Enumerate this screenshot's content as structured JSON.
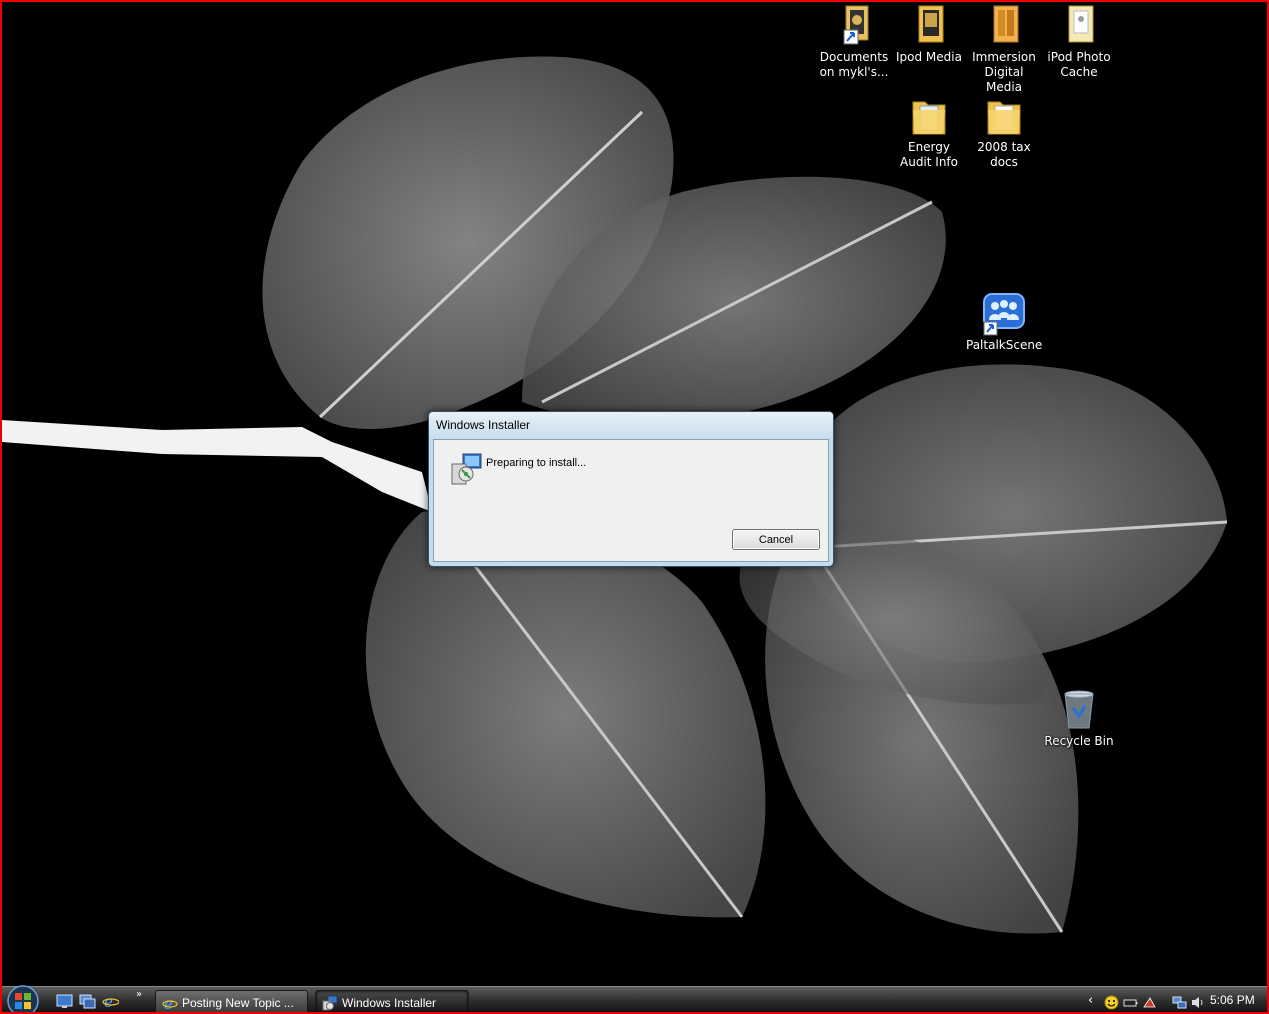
{
  "desktop_icons": [
    {
      "id": "documents",
      "label": "Documents on mykl's..."
    },
    {
      "id": "ipod-media",
      "label": "Ipod Media"
    },
    {
      "id": "immersion",
      "label": "Immersion Digital Media"
    },
    {
      "id": "ipod-photo",
      "label": "iPod Photo Cache"
    },
    {
      "id": "energy",
      "label": "Energy Audit Info"
    },
    {
      "id": "tax",
      "label": "2008 tax docs"
    },
    {
      "id": "paltalk",
      "label": "PaltalkScene"
    },
    {
      "id": "recycle",
      "label": "Recycle Bin"
    }
  ],
  "dialog": {
    "title": "Windows Installer",
    "message": "Preparing to install...",
    "cancel_label": "Cancel"
  },
  "taskbar": {
    "more_symbol": "»",
    "tasks": [
      {
        "label": "Posting New Topic ..."
      },
      {
        "label": "Windows Installer"
      }
    ],
    "tray_chevron": "‹",
    "clock": "5:06 PM"
  },
  "colors": {
    "frame": "#e00000",
    "folder": "#f1c24b",
    "accent": "#2a6fd6"
  }
}
